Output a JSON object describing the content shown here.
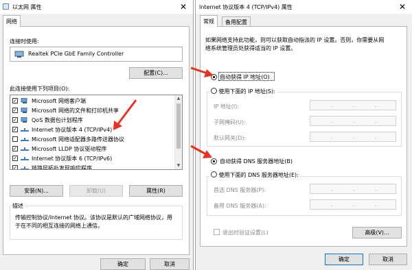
{
  "left": {
    "title": "以太网 属性",
    "tab": "网络",
    "connect_using_label": "连接时使用:",
    "adapter_name": "Realtek PCIe GbE Family Controller",
    "configure_button": "配置(C)...",
    "items_label": "此连接使用下列项目(O):",
    "items": [
      {
        "label": "Microsoft 网络客户端",
        "checked": true,
        "icon": "network-client-icon"
      },
      {
        "label": "Microsoft 网络的文件和打印机共享",
        "checked": true,
        "icon": "network-service-icon"
      },
      {
        "label": "QoS 数据包计划程序",
        "checked": true,
        "icon": "network-service-icon"
      },
      {
        "label": "Internet 协议版本 4 (TCP/IPv4)",
        "checked": true,
        "icon": "protocol-icon"
      },
      {
        "label": "Microsoft 网络适配器多路传送器协议",
        "checked": false,
        "icon": "protocol-icon"
      },
      {
        "label": "Microsoft LLDP 协议驱动程序",
        "checked": true,
        "icon": "protocol-icon"
      },
      {
        "label": "Internet 协议版本 6 (TCP/IPv6)",
        "checked": true,
        "icon": "protocol-icon"
      },
      {
        "label": "链路层拓扑发现响应程序",
        "checked": true,
        "icon": "protocol-icon"
      }
    ],
    "install_button": "安装(N)...",
    "uninstall_button": "卸载(U)",
    "properties_button": "属性(R)",
    "description_label": "描述",
    "description_line1": "传输控制协议/Internet 协议。该协议是默认的广域网络协议，用",
    "description_line2": "于在不同的相互连接的网络上通信。",
    "ok_button": "确定",
    "cancel_button": "取消"
  },
  "right": {
    "title": "Internet 协议版本 4 (TCP/IPv4) 属性",
    "tabs": [
      "常规",
      "备用配置"
    ],
    "intro_line1": "如果网络支持此功能，则可以获取自动指派的 IP 设置。否则，你需要从网",
    "intro_line2": "络系统管理员处获得适当的 IP 设置。",
    "auto_ip_label": "自动获得 IP 地址(O)",
    "manual_ip_label": "使用下面的 IP 地址(S):",
    "ip_address_label": "IP 地址(I):",
    "subnet_label": "子网掩码(U):",
    "gateway_label": "默认网关(D):",
    "auto_dns_label": "自动获得 DNS 服务器地址(B)",
    "manual_dns_label": "使用下面的 DNS 服务器地址(E):",
    "preferred_dns_label": "首选 DNS 服务器(P):",
    "alternate_dns_label": "备用 DNS 服务器(A):",
    "validate_label": "退出时验证设置(L)",
    "advanced_button": "高级(V)...",
    "ok_button": "确定",
    "cancel_button": "取消",
    "auto_ip_selected": true,
    "auto_dns_selected": true
  },
  "colors": {
    "annotation_arrow": "#e8321f",
    "window_bg": "#f0f0f0",
    "accent": "#0078d7"
  }
}
